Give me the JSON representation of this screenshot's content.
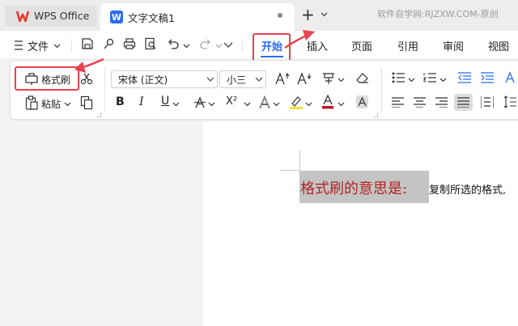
{
  "titlebar": {
    "app_tab_label": "WPS Office",
    "doc_tab_label": "文字文稿1",
    "doc_icon_letter": "W",
    "new_tab_symbol": "+",
    "watermark": "软件自学网:RJZXW.COM-原创"
  },
  "menu": {
    "file_label": "文件",
    "tabs": [
      "开始",
      "插入",
      "页面",
      "引用",
      "审阅",
      "视图"
    ],
    "active_tab": "开始"
  },
  "ribbon": {
    "format_painter_label": "格式刷",
    "paste_label": "粘贴",
    "font_name": "宋体 (正文)",
    "font_size": "小三"
  },
  "document": {
    "heading_text": "格式刷的意思是:",
    "body_text": "复制所选的格式,"
  },
  "colors": {
    "accent": "#2a6bf2",
    "annotation_red": "#e8414f",
    "doc_red_text": "#b22424",
    "wps_logo": "#e63b2e"
  },
  "icons": [
    "wps-logo-icon",
    "doc-icon",
    "caret-down-icon",
    "menu-icon",
    "save-icon",
    "share-icon",
    "print-icon",
    "preview-icon",
    "undo-icon",
    "redo-icon",
    "format-painter-icon",
    "scissors-icon",
    "paste-icon",
    "copy-icon",
    "bold-icon",
    "italic-icon",
    "underline-icon",
    "strikethrough-icon",
    "superscript-icon",
    "text-effect-icon",
    "highlight-icon",
    "font-color-icon",
    "char-shading-icon",
    "grow-font-icon",
    "shrink-font-icon",
    "phonetic-icon",
    "clear-format-icon",
    "bullets-icon",
    "numbering-icon",
    "decrease-indent-icon",
    "increase-indent-icon",
    "align-left-icon",
    "align-center-icon",
    "align-right-icon",
    "justify-icon",
    "distributed-icon",
    "line-spacing-icon"
  ]
}
